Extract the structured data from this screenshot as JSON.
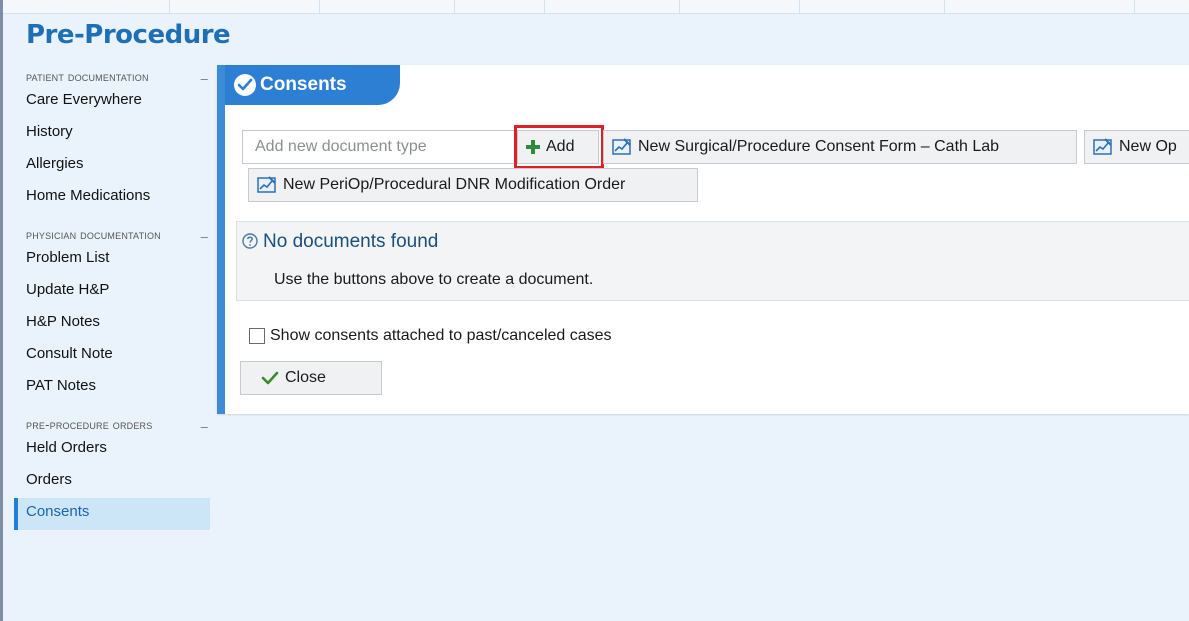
{
  "page": {
    "title": "Pre-Procedure"
  },
  "sidebar": {
    "sections": [
      {
        "heading": "Patient Documentation",
        "collapse": "–",
        "items": [
          "Care Everywhere",
          "History",
          "Allergies",
          "Home Medications"
        ]
      },
      {
        "heading": "Physician Documentation",
        "collapse": "–",
        "items": [
          "Problem List",
          "Update H&P",
          "H&P Notes",
          "Consult Note",
          "PAT Notes"
        ]
      },
      {
        "heading": "Pre-Procedure Orders",
        "collapse": "–",
        "items": [
          "Held Orders",
          "Orders",
          "Consents"
        ]
      }
    ],
    "active_item": "Consents"
  },
  "consents": {
    "title": "Consents",
    "input_placeholder": "Add new document type",
    "add_label": "Add",
    "buttons": [
      "New Surgical/Procedure Consent Form – Cath Lab",
      "New Op",
      "New PeriOp/Procedural DNR Modification Order"
    ],
    "empty_title": "No documents found",
    "empty_message": "Use the buttons above to create a document.",
    "checkbox_label": "Show consents attached to past/canceled cases",
    "checkbox_checked": false,
    "close_label": "Close"
  },
  "colors": {
    "accent": "#2d7fd4",
    "title": "#1f6fb6",
    "highlight": "#e01f26",
    "add_icon": "#2e8b3e"
  },
  "icons": {
    "tab": "consent-check-icon",
    "add": "plus-icon",
    "doc": "chart-document-icon",
    "help": "question-circle-icon",
    "close": "checkmark-icon"
  }
}
